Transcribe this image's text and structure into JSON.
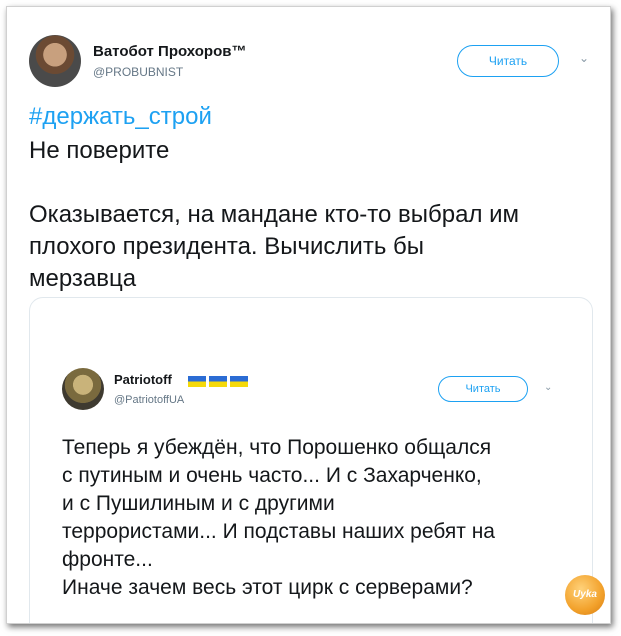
{
  "tweet": {
    "author_name": "Ватобот Прохоров™",
    "author_handle": "@PROBUBNIST",
    "follow_label": "Читать",
    "hashtag": "#держать_строй",
    "lines": [
      "Не поверите",
      "Оказывается, на мандане кто-то выбрал им",
      "плохого президента. Вычислить бы",
      "мерзавца"
    ]
  },
  "embedded_tweet": {
    "author_name": "Patriotoff",
    "author_handle": "@PatriotoffUA",
    "follow_label": "Читать",
    "lines": [
      "Теперь я убеждён, что Порошенко общался",
      "с путиным и очень часто... И с Захарченко,",
      "и с Пушилиным и с другими",
      "террористами... И подставы наших ребят на",
      "фронте...",
      "Иначе зачем весь этот цирк с серверами?"
    ]
  },
  "watermark": {
    "text": "Uyka"
  },
  "colors": {
    "accent": "#1da1f2",
    "text": "#14171a",
    "muted": "#657786"
  }
}
